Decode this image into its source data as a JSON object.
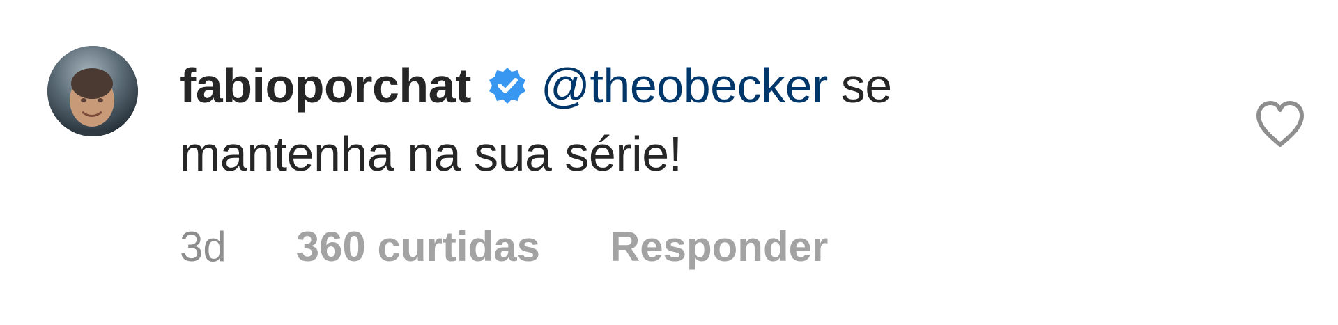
{
  "comment": {
    "username": "fabioporchat",
    "verified_icon": "verified-badge-icon",
    "mention": "@theobecker",
    "text_after_mention": " se",
    "second_line": "mantenha na sua série!",
    "time": "3d",
    "likes": "360 curtidas",
    "reply": "Responder",
    "like_icon": "heart-outline-icon"
  },
  "colors": {
    "username": "#262626",
    "mention": "#00376b",
    "meta": "#8e8e8e",
    "verified": "#3897f0"
  }
}
